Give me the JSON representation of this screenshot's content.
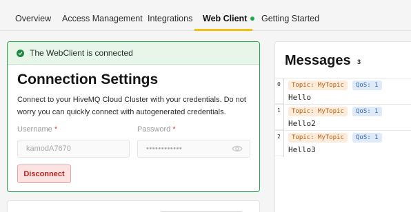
{
  "nav": {
    "tabs": [
      {
        "label": "Overview"
      },
      {
        "label": "Access Management"
      },
      {
        "label": "Integrations"
      },
      {
        "label": "Web Client",
        "active": true
      },
      {
        "label": "Getting Started"
      }
    ]
  },
  "connection": {
    "alert": "The WebClient is connected",
    "title": "Connection Settings",
    "description": "Connect to your HiveMQ Cloud Cluster with your credentials. Do not worry you can quickly connect with autogenerated credentials.",
    "username_label": "Username",
    "password_label": "Password",
    "required_mark": "*",
    "username_value": "kamodA7670",
    "password_value": "••••••••••••",
    "disconnect_label": "Disconnect"
  },
  "messages": {
    "title": "Messages",
    "count": "3",
    "items": [
      {
        "index": "0",
        "topic": "Topic: MyTopic",
        "qos": "QoS: 1",
        "payload": "Hello"
      },
      {
        "index": "1",
        "topic": "Topic: MyTopic",
        "qos": "QoS: 1",
        "payload": "Hello2"
      },
      {
        "index": "2",
        "topic": "Topic: MyTopic",
        "qos": "QoS: 1",
        "payload": "Hello3"
      }
    ]
  },
  "colors": {
    "accent_yellow": "#f0c20e",
    "success_green": "#1fa84a",
    "danger_red": "#b3261e"
  }
}
